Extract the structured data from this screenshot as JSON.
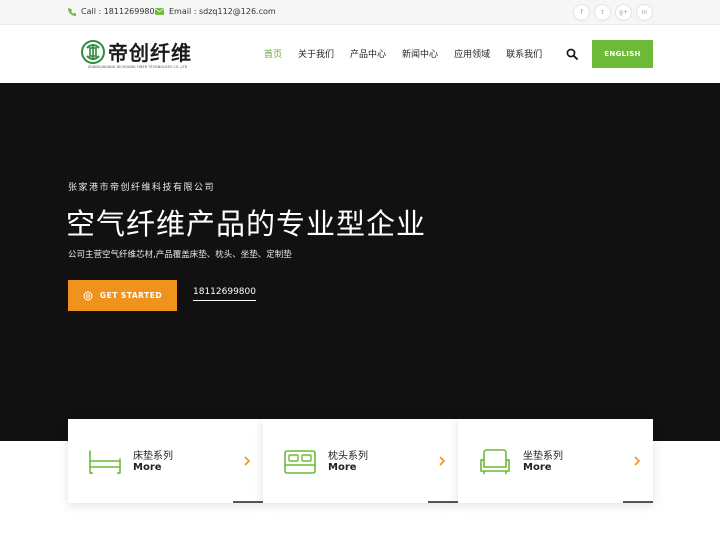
{
  "topbar": {
    "phone": "Call : 18112699800",
    "email": "Email : sdzq112@126.com",
    "socials": [
      {
        "icon": "facebook-icon",
        "glyph": "f"
      },
      {
        "icon": "twitter-icon",
        "glyph": "t"
      },
      {
        "icon": "google-plus-icon",
        "glyph": "g+"
      },
      {
        "icon": "linkedin-icon",
        "glyph": "in"
      }
    ]
  },
  "header": {
    "logo_text": "帝创纤维",
    "logo_subtext": "ZHANGJIAGANG DICHUANG FIBER TECHNOLOGY CO.,LTD",
    "nav": [
      "首页",
      "关于我们",
      "产品中心",
      "新闻中心",
      "应用领域",
      "联系我们"
    ],
    "active_index": 0,
    "english_button": "ENGLISH"
  },
  "hero": {
    "kicker": "张家港市帝创纤维科技有限公司",
    "title": "空气纤维产品的专业型企业",
    "subtitle": "公司主营空气纤维芯材,产品覆盖床垫、枕头、坐垫、定制垫",
    "cta": "GET STARTED",
    "phone_link": "18112699800"
  },
  "cards": [
    {
      "title": "床垫系列",
      "more": "More",
      "icon": "bed-icon"
    },
    {
      "title": "枕头系列",
      "more": "More",
      "icon": "pillow-icon"
    },
    {
      "title": "坐垫系列",
      "more": "More",
      "icon": "sofa-icon"
    }
  ],
  "colors": {
    "brand_green": "#6cba38",
    "nav_active": "#63ab2f",
    "cta_orange": "#f0921e",
    "hero_bg": "#111111"
  }
}
